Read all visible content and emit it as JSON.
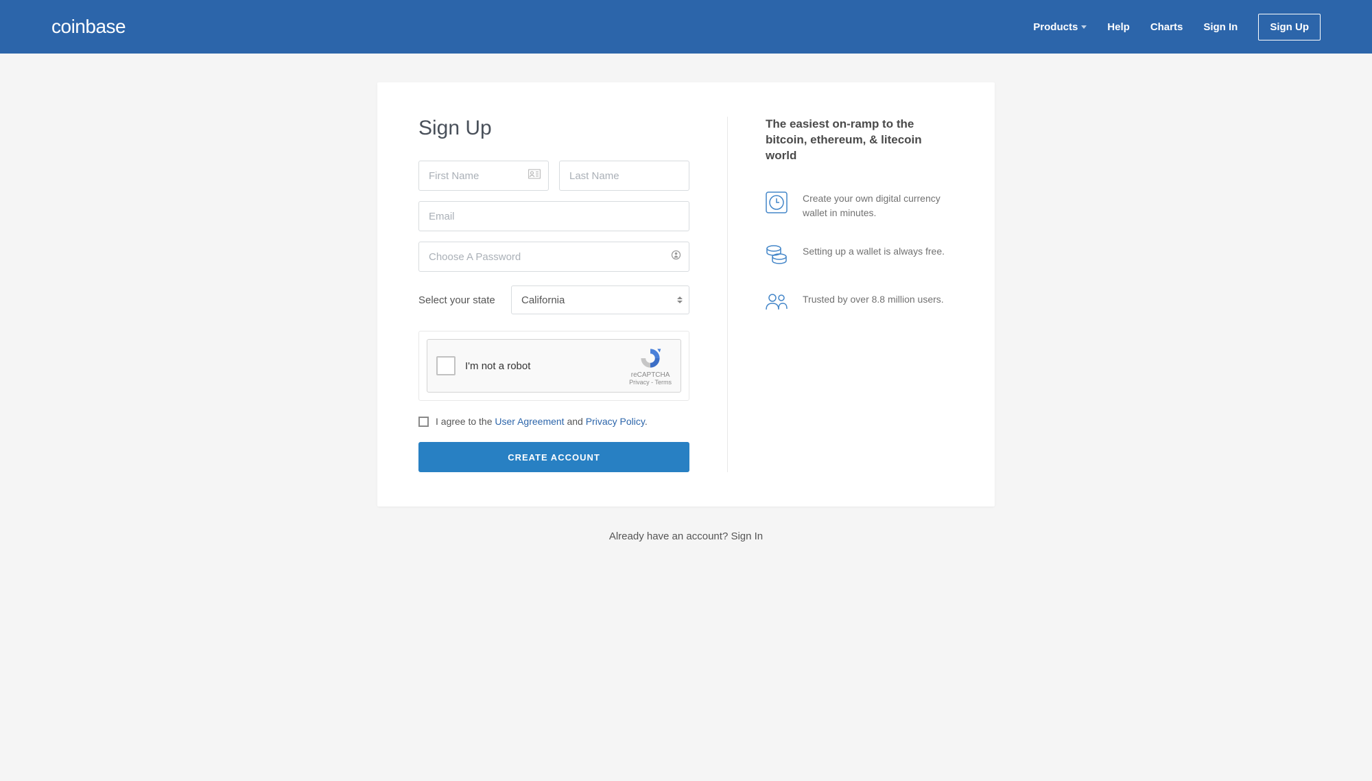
{
  "header": {
    "logo": "coinbase",
    "nav": {
      "products": "Products",
      "help": "Help",
      "charts": "Charts",
      "signin": "Sign In",
      "signup": "Sign Up"
    }
  },
  "form": {
    "title": "Sign Up",
    "first_name_placeholder": "First Name",
    "last_name_placeholder": "Last Name",
    "email_placeholder": "Email",
    "password_placeholder": "Choose A Password",
    "state_label": "Select your state",
    "state_value": "California",
    "recaptcha_text": "I'm not a robot",
    "recaptcha_label": "reCAPTCHA",
    "recaptcha_links": "Privacy - Terms",
    "agree_prefix": "I agree to the ",
    "user_agreement": "User Agreement",
    "agree_mid": " and ",
    "privacy_policy": "Privacy Policy",
    "agree_suffix": ".",
    "create_button": "CREATE ACCOUNT"
  },
  "sidebar": {
    "heading": "The easiest on-ramp to the bitcoin, ethereum, & litecoin world",
    "features": [
      {
        "text": "Create your own digital currency wallet in minutes."
      },
      {
        "text": "Setting up a wallet is always free."
      },
      {
        "text": "Trusted by over 8.8 million users."
      }
    ]
  },
  "footer": {
    "text_prefix": "Already have an account? ",
    "signin": "Sign In"
  }
}
